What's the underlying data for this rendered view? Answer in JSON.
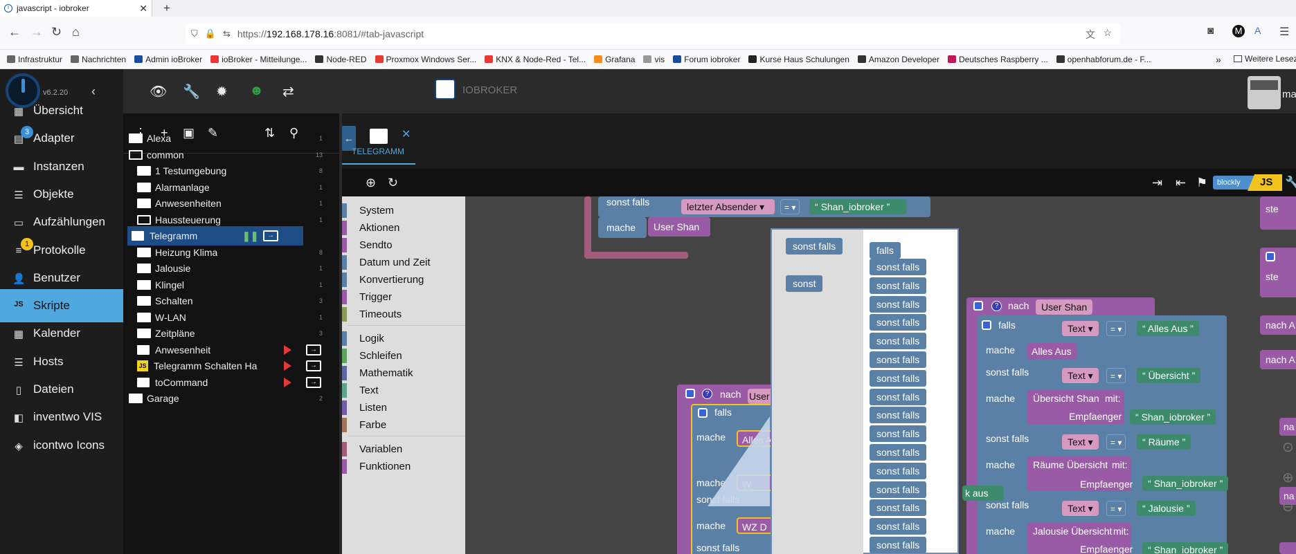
{
  "browser": {
    "tab_title": "javascript - iobroker",
    "url_prefix": "https://",
    "url_host": "192.168.178.16",
    "url_rest": ":8081/#tab-javascript"
  },
  "bookmarks": [
    {
      "label": "Infrastruktur",
      "color": "#666"
    },
    {
      "label": "Nachrichten",
      "color": "#666"
    },
    {
      "label": "Admin ioBroker",
      "color": "#1a4d99"
    },
    {
      "label": "ioBroker - Mitteilunge...",
      "color": "#e53935"
    },
    {
      "label": "Node-RED",
      "color": "#333"
    },
    {
      "label": "Proxmox Windows Ser...",
      "color": "#e53935"
    },
    {
      "label": "KNX & Node-Red - Tel...",
      "color": "#e53935"
    },
    {
      "label": "Grafana",
      "color": "#f58a1f"
    },
    {
      "label": "vis",
      "color": "#999"
    },
    {
      "label": "Forum iobroker",
      "color": "#1a4d99"
    },
    {
      "label": "Kurse Haus Schulungen",
      "color": "#222"
    },
    {
      "label": "Amazon Developer",
      "color": "#333"
    },
    {
      "label": "Deutsches Raspberry ...",
      "color": "#c2185b"
    },
    {
      "label": "openhabforum.de - F...",
      "color": "#333"
    }
  ],
  "bookmarks_more": "Weitere Lesez",
  "sidebar": {
    "version": "v6.2.20",
    "items": [
      {
        "label": "Übersicht",
        "icon": "grid-icon"
      },
      {
        "label": "Adapter",
        "icon": "store-icon",
        "badge": "3"
      },
      {
        "label": "Instanzen",
        "icon": "instances-icon"
      },
      {
        "label": "Objekte",
        "icon": "list-icon"
      },
      {
        "label": "Aufzählungen",
        "icon": "enum-icon"
      },
      {
        "label": "Protokolle",
        "icon": "log-icon",
        "badge": "1"
      },
      {
        "label": "Benutzer",
        "icon": "user-icon"
      },
      {
        "label": "Skripte",
        "icon": "js-icon",
        "active": true
      },
      {
        "label": "Kalender",
        "icon": "calendar-icon"
      },
      {
        "label": "Hosts",
        "icon": "hosts-icon"
      },
      {
        "label": "Dateien",
        "icon": "file-icon"
      },
      {
        "label": "inventwo VIS",
        "icon": "inventwo-icon"
      },
      {
        "label": "icontwo Icons",
        "icon": "icontwo-icon"
      }
    ]
  },
  "header": {
    "brand": "IOBROKER",
    "user": "ma"
  },
  "tree": [
    {
      "label": "Alexa",
      "count": "1",
      "level": 0,
      "type": "folder"
    },
    {
      "label": "common",
      "count": "13",
      "level": 0,
      "type": "folder-open"
    },
    {
      "label": "1 Testumgebung",
      "count": "8",
      "level": 1,
      "type": "folder"
    },
    {
      "label": "Alarmanlage",
      "count": "1",
      "level": 1,
      "type": "folder"
    },
    {
      "label": "Anwesenheiten",
      "count": "1",
      "level": 1,
      "type": "folder"
    },
    {
      "label": "Haussteuerung",
      "count": "1",
      "level": 1,
      "type": "folder-open"
    },
    {
      "label": "Telegramm",
      "count": "",
      "level": 2,
      "type": "script",
      "selected": true,
      "state": "running"
    },
    {
      "label": "Heizung Klima",
      "count": "8",
      "level": 1,
      "type": "folder"
    },
    {
      "label": "Jalousie",
      "count": "1",
      "level": 1,
      "type": "folder"
    },
    {
      "label": "Klingel",
      "count": "1",
      "level": 1,
      "type": "folder"
    },
    {
      "label": "Schalten",
      "count": "3",
      "level": 1,
      "type": "folder"
    },
    {
      "label": "W-LAN",
      "count": "1",
      "level": 1,
      "type": "folder"
    },
    {
      "label": "Zeitpläne",
      "count": "3",
      "level": 1,
      "type": "folder"
    },
    {
      "label": "Anwesenheit",
      "count": "",
      "level": 1,
      "type": "script",
      "state": "stopped"
    },
    {
      "label": "Telegramm Schalten Haus",
      "count": "",
      "level": 1,
      "type": "js",
      "state": "stopped"
    },
    {
      "label": "toCommand",
      "count": "",
      "level": 1,
      "type": "script",
      "state": "stopped"
    },
    {
      "label": "Garage",
      "count": "2",
      "level": 0,
      "type": "folder"
    }
  ],
  "editor": {
    "tab_label": "TELEGRAMM",
    "blockly_label": "blockly",
    "js_label": "JS"
  },
  "toolbox": [
    {
      "label": "System",
      "color": "#5b80a5"
    },
    {
      "label": "Aktionen",
      "color": "#995ba5"
    },
    {
      "label": "Sendto",
      "color": "#995ba5"
    },
    {
      "label": "Datum und Zeit",
      "color": "#5b80a5"
    },
    {
      "label": "Konvertierung",
      "color": "#5b80a5"
    },
    {
      "label": "Trigger",
      "color": "#995ba5"
    },
    {
      "label": "Timeouts",
      "color": "#8a9a5b"
    },
    {
      "label": "Logik",
      "color": "#5b80a5",
      "sep_before": true
    },
    {
      "label": "Schleifen",
      "color": "#5ba55b"
    },
    {
      "label": "Mathematik",
      "color": "#5b67a5"
    },
    {
      "label": "Text",
      "color": "#5ba58c"
    },
    {
      "label": "Listen",
      "color": "#745ba5"
    },
    {
      "label": "Farbe",
      "color": "#a5745b"
    },
    {
      "label": "Variablen",
      "color": "#a55b80",
      "sep_before": true
    },
    {
      "label": "Funktionen",
      "color": "#995ba5"
    }
  ],
  "blocks": {
    "sonst_falls": "sonst falls",
    "mache": "mache",
    "falls": "falls",
    "sonst": "sonst",
    "nach": "nach",
    "mit": "mit:",
    "empfaenger": "Empfaenger",
    "letzter_absender": "letzter Absender",
    "eq": "=",
    "shan_iobroker": "Shan_iobroker",
    "user_shan": "User Shan",
    "text": "Text",
    "alles_aus": "Alles Aus",
    "uebersicht": "Übersicht",
    "uebersicht_shan": "Übersicht Shan",
    "raeume": "Räume",
    "raeume_uebersicht": "Räume Übersicht",
    "jalousie": "Jalousie",
    "jalousie_uebersicht": "Jalousie Übersicht",
    "alles_a": "Alles A",
    "wz_d": "WZ D",
    "user_partial": "User",
    "w_partial": "W",
    "k_aus": "k aus",
    "alles_partial": "Alles",
    "ste": "ste",
    "nach_a": "nach A",
    "na": "na"
  },
  "mutator": {
    "palette": [
      "sonst falls",
      "sonst"
    ],
    "stack_head": "falls",
    "stack_items": [
      "sonst falls",
      "sonst falls",
      "sonst falls",
      "sonst falls",
      "sonst falls",
      "sonst falls",
      "sonst falls",
      "sonst falls",
      "sonst falls",
      "sonst falls",
      "sonst falls",
      "sonst falls",
      "sonst falls",
      "sonst falls",
      "sonst falls",
      "sonst falls"
    ]
  }
}
